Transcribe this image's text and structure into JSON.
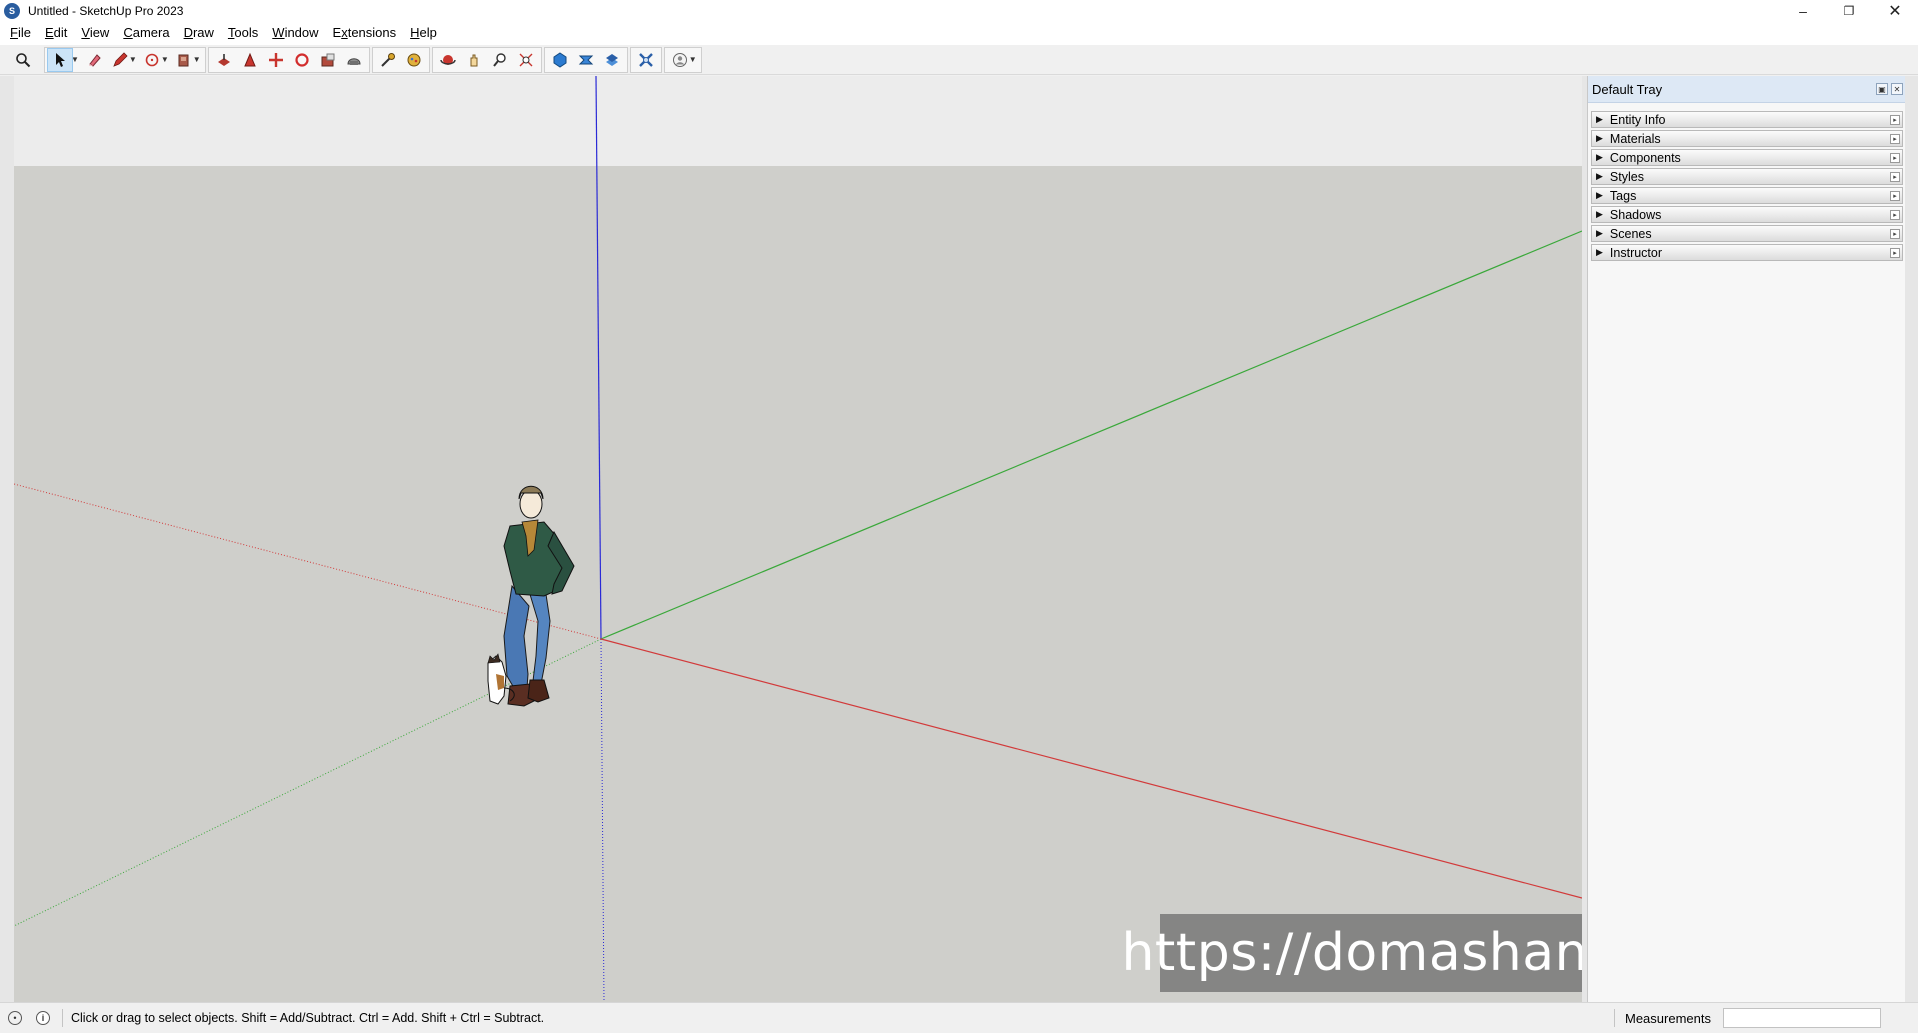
{
  "window": {
    "title": "Untitled - SketchUp Pro 2023",
    "app_icon": "sketchup-logo",
    "controls": [
      "minimize-icon",
      "restore-icon",
      "close-icon"
    ]
  },
  "menu": [
    {
      "label": "File",
      "mnemonic": "F",
      "rest": "ile"
    },
    {
      "label": "Edit",
      "mnemonic": "E",
      "rest": "dit"
    },
    {
      "label": "View",
      "mnemonic": "V",
      "rest": "iew"
    },
    {
      "label": "Camera",
      "mnemonic": "C",
      "rest": "amera"
    },
    {
      "label": "Draw",
      "mnemonic": "D",
      "rest": "raw"
    },
    {
      "label": "Tools",
      "mnemonic": "T",
      "rest": "ools"
    },
    {
      "label": "Window",
      "mnemonic": "W",
      "rest": "indow"
    },
    {
      "label": "Extensions",
      "mnemonic": "x",
      "prefix": "E",
      "rest": "tensions"
    },
    {
      "label": "Help",
      "mnemonic": "H",
      "rest": "elp"
    }
  ],
  "toolbar": {
    "tools": [
      "search-icon",
      "select-icon",
      "eraser-icon",
      "pencil-icon",
      "rectangle-icon",
      "push-pull-icon",
      "move-icon",
      "offset-icon",
      "rotate-icon",
      "scale-icon",
      "follow-me-icon",
      "tape-measure-icon",
      "paint-bucket-icon",
      "orbit-icon",
      "pan-icon",
      "zoom-icon",
      "zoom-extents-icon",
      "warehouse-icon",
      "extension-warehouse-icon",
      "layout-icon",
      "extension-manager-icon",
      "account-icon"
    ],
    "active_tool": "select-icon"
  },
  "viewport": {
    "background_color": "#cfcfcb",
    "sky_color": "#ececec",
    "axis_colors": {
      "red": "#d23a3a",
      "green": "#3aa83a",
      "blue": "#2a2ad6"
    },
    "figure": "scale-figure-person-with-cat"
  },
  "watermark": {
    "text": "https://domashand.tistory.com"
  },
  "tray": {
    "title": "Default Tray",
    "panels": [
      "Entity Info",
      "Materials",
      "Components",
      "Styles",
      "Tags",
      "Shadows",
      "Scenes",
      "Instructor"
    ]
  },
  "statusbar": {
    "hint": "Click or drag to select objects. Shift = Add/Subtract. Ctrl = Add. Shift + Ctrl = Subtract.",
    "measurements_label": "Measurements",
    "measurements_value": ""
  }
}
